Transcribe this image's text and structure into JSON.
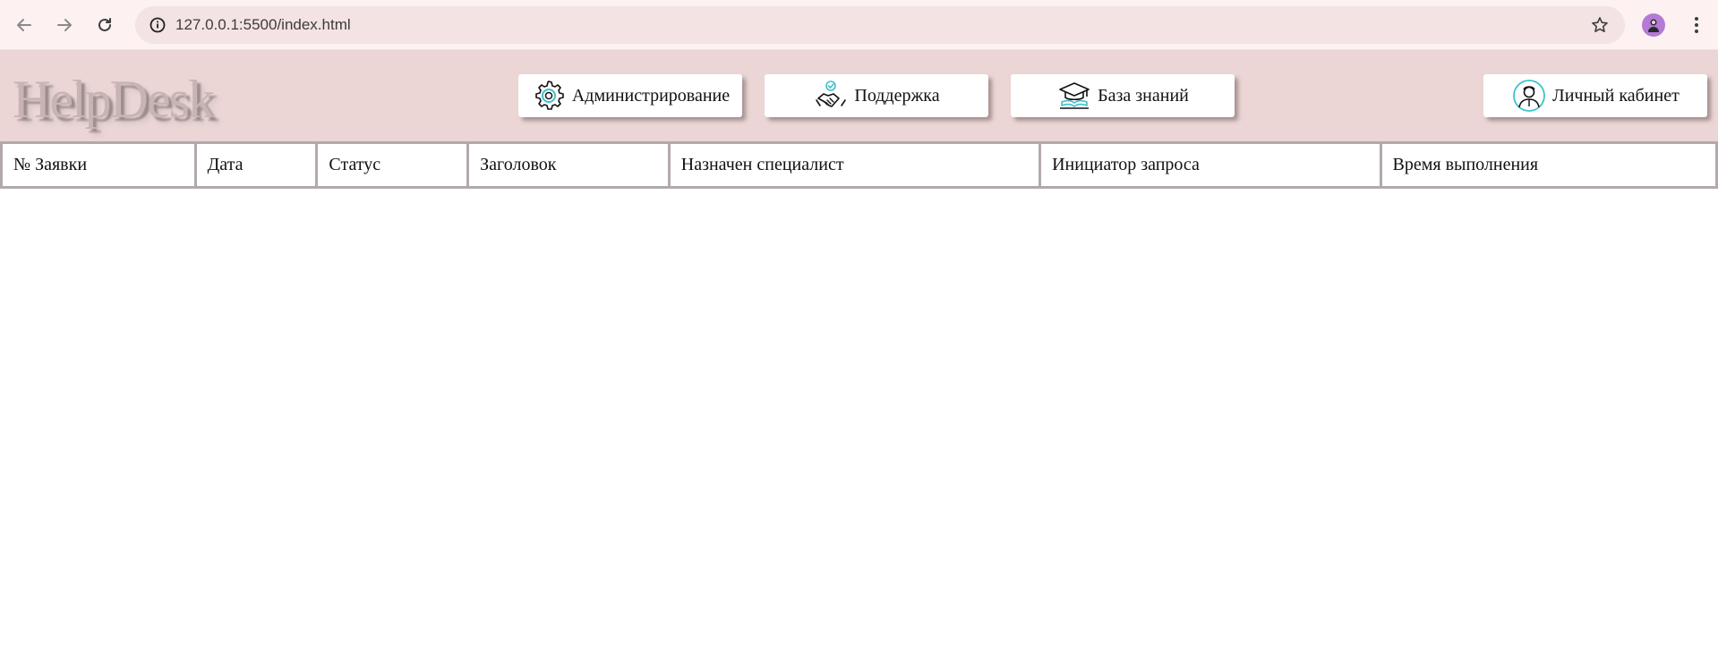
{
  "browser": {
    "url": "127.0.0.1:5500/index.html",
    "back_icon": "arrow-left-icon",
    "forward_icon": "arrow-right-icon",
    "reload_icon": "reload-icon",
    "site_info_icon": "info-icon",
    "bookmark_icon": "star-icon",
    "menu_icon": "kebab-menu-icon"
  },
  "header": {
    "logo": "HelpDesk",
    "nav": {
      "admin_label": "Администрирование",
      "support_label": "Поддержка",
      "kb_label": "База знаний",
      "account_label": "Личный кабинет"
    }
  },
  "table": {
    "columns": {
      "number": "№ Заявки",
      "date": "Дата",
      "status": "Статус",
      "title": "Заголовок",
      "assignee": "Назначен специалист",
      "initiator": "Инициатор запроса",
      "duration": "Время выполнения"
    },
    "rows": []
  },
  "colors": {
    "header_bg": "#ebd6d5",
    "chrome_bg": "#fdf2f1",
    "table_border": "#b3a9ab",
    "icon_accent": "#3fc1c9"
  }
}
